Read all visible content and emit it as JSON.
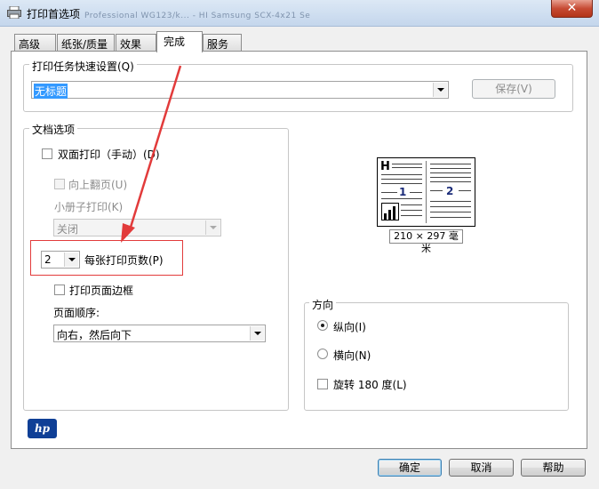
{
  "window": {
    "title": "打印首选项",
    "ghost_title": "Professional WG123/k... - HI Samsung SCX-4x21 Se",
    "close_label": "✕"
  },
  "tabs": [
    {
      "label": "高级",
      "active": false
    },
    {
      "label": "纸张/质量",
      "active": false
    },
    {
      "label": "效果",
      "active": false
    },
    {
      "label": "完成",
      "active": true
    },
    {
      "label": "服务",
      "active": false
    }
  ],
  "quick_settings": {
    "legend": "打印任务快速设置(Q)",
    "value": "无标题",
    "save_label": "保存(V)"
  },
  "doc_options": {
    "legend": "文档选项",
    "duplex_label": "双面打印（手动）(D)",
    "flip_up_label": "向上翻页(U)",
    "booklet_label": "小册子打印(K)",
    "booklet_value": "关闭",
    "pages_per_sheet_value": "2",
    "pages_per_sheet_label": "每张打印页数(P)",
    "page_borders_label": "打印页面边框",
    "page_order_label": "页面顺序:",
    "page_order_value": "向右，然后向下"
  },
  "preview": {
    "header_letter": "H",
    "page_numbers": [
      "1",
      "2"
    ],
    "paper_size": "210 × 297 毫米"
  },
  "orientation": {
    "legend": "方向",
    "portrait_label": "纵向(I)",
    "landscape_label": "横向(N)",
    "rotate_label": "旋转 180 度(L)",
    "selected": "portrait"
  },
  "brand": {
    "logo_text": "hp"
  },
  "footer": {
    "ok_label": "确定",
    "cancel_label": "取消",
    "help_label": "帮助"
  },
  "colors": {
    "highlight": "#e23b3b",
    "arrow": "#e23b3b",
    "hp_blue": "#0f3f96",
    "selection": "#3399ff"
  }
}
